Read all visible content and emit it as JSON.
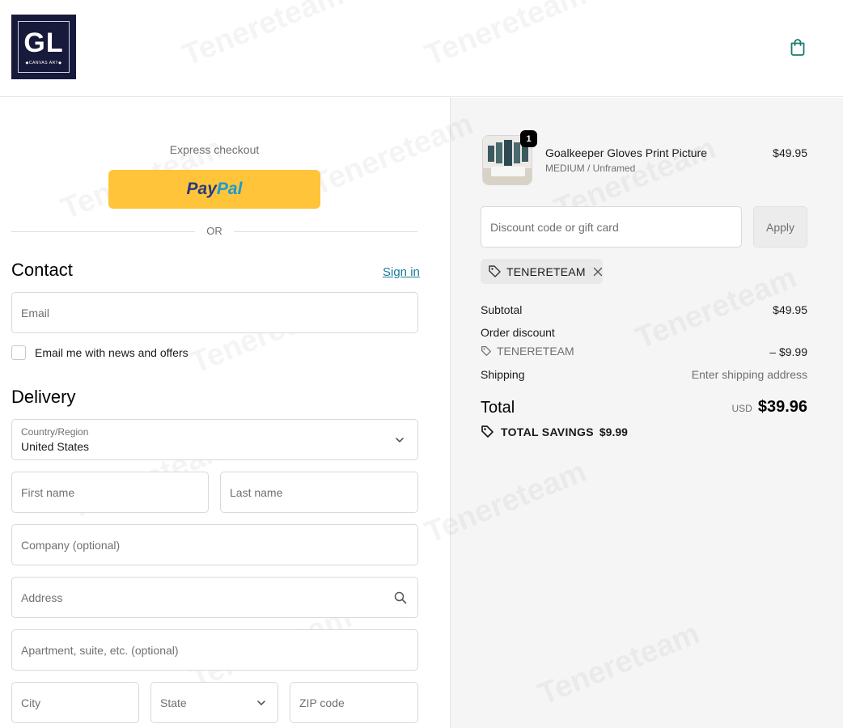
{
  "header": {
    "logo_text": "GL",
    "logo_subtext": "◆CANVAS ART◆",
    "cart_icon": "shopping-bag-icon"
  },
  "express": {
    "label": "Express checkout",
    "paypal_pay": "Pay",
    "paypal_pal": "Pal",
    "or_label": "OR"
  },
  "contact": {
    "heading": "Contact",
    "sign_in": "Sign in",
    "email_placeholder": "Email",
    "newsletter_label": "Email me with news and offers"
  },
  "delivery": {
    "heading": "Delivery",
    "country_label": "Country/Region",
    "country_value": "United States",
    "first_name_placeholder": "First name",
    "last_name_placeholder": "Last name",
    "company_placeholder": "Company (optional)",
    "address_placeholder": "Address",
    "apartment_placeholder": "Apartment, suite, etc. (optional)",
    "city_placeholder": "City",
    "state_placeholder": "State",
    "zip_placeholder": "ZIP code"
  },
  "summary": {
    "product": {
      "quantity": "1",
      "name": "Goalkeeper Gloves Print Picture",
      "variant": "MEDIUM / Unframed",
      "price": "$49.95"
    },
    "discount_placeholder": "Discount code or gift card",
    "apply_label": "Apply",
    "applied_code": "TENERETEAM",
    "subtotal_label": "Subtotal",
    "subtotal_value": "$49.95",
    "order_discount_label": "Order discount",
    "order_discount_code": "TENERETEAM",
    "order_discount_value": "– $9.99",
    "shipping_label": "Shipping",
    "shipping_value": "Enter shipping address",
    "total_label": "Total",
    "total_currency": "USD",
    "total_value": "$39.96",
    "savings_label": "TOTAL SAVINGS",
    "savings_value": "$9.99"
  },
  "watermark": "Tenereteam",
  "colors": {
    "paypal_yellow": "#ffc439",
    "paypal_dark_blue": "#253b80",
    "paypal_light_blue": "#179bd7",
    "link": "#1a7a99",
    "cart_icon": "#1a7a6e",
    "logo_bg": "#171a3a",
    "summary_bg": "#f5f5f5"
  }
}
